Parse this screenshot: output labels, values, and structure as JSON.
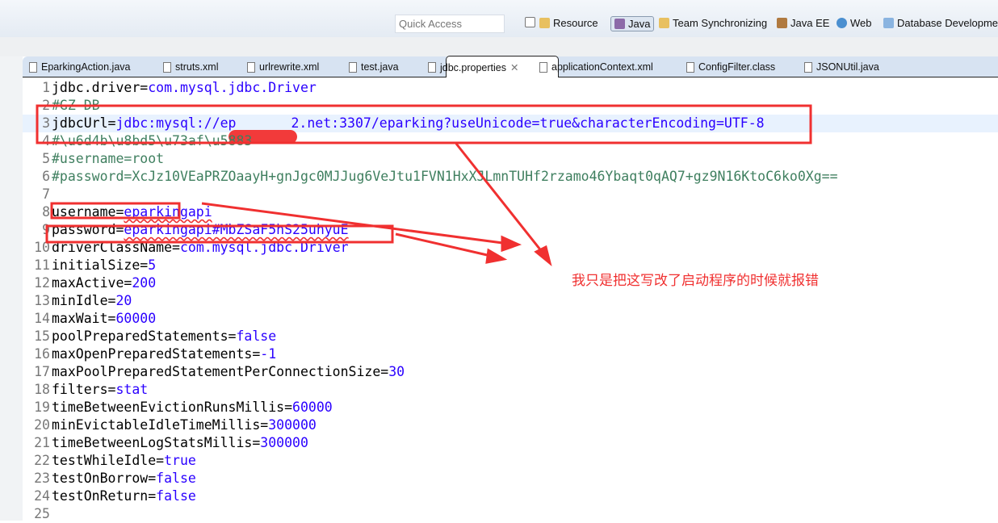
{
  "toolbar": {
    "quick_access_placeholder": "Quick Access",
    "perspectives": [
      {
        "label": "Resource"
      },
      {
        "label": "Java",
        "active": true
      },
      {
        "label": "Team Synchronizing"
      },
      {
        "label": "Java EE"
      },
      {
        "label": "Web"
      },
      {
        "label": "Database Developme"
      }
    ]
  },
  "tabs": [
    {
      "label": "EparkingAction.java"
    },
    {
      "label": "struts.xml"
    },
    {
      "label": "urlrewrite.xml"
    },
    {
      "label": "test.java"
    },
    {
      "label": "jdbc.properties",
      "active": true
    },
    {
      "label": "applicationContext.xml"
    },
    {
      "label": "ConfigFilter.class"
    },
    {
      "label": "JSONUtil.java"
    }
  ],
  "colors": {
    "key": "#000000",
    "value": "#2a00ff",
    "comment": "#3f7f5f",
    "annotation": "#f03030"
  },
  "editor": {
    "lines": [
      {
        "n": "1",
        "k": "jdbc.driver=",
        "v": "com.mysql.jdbc.Driver"
      },
      {
        "n": "2",
        "c": "#GZ DB"
      },
      {
        "n": "3",
        "k": "jdbcUrl=",
        "v": "jdbc:mysql://ep",
        "v2": "2.net:3307/eparking?useUnicode=true&characterEncoding=UTF-8"
      },
      {
        "n": "4",
        "c": "#\\u6d4b\\u8bd5\\u73af\\u5883"
      },
      {
        "n": "5",
        "c": "#username=root"
      },
      {
        "n": "6",
        "c": "#password=XcJz10VEaPRZOaayH+gnJgc0MJJug6VeJtu1FVN1HxXJLmnTUHf2rzamo46Ybaqt0qAQ7+gz9N16KtoC6ko0Xg=="
      },
      {
        "n": "7"
      },
      {
        "n": "8",
        "k": "username=",
        "v": "eparkingapi"
      },
      {
        "n": "9",
        "k": "password=",
        "v": "eparkingapi#MbZSaF5hS25uhyuE"
      },
      {
        "n": "10",
        "k": "driverClassName=",
        "v": "com.mysql.jdbc.Driver"
      },
      {
        "n": "11",
        "k": "initialSize=",
        "v": "5"
      },
      {
        "n": "12",
        "k": "maxActive=",
        "v": "200"
      },
      {
        "n": "13",
        "k": "minIdle=",
        "v": "20"
      },
      {
        "n": "14",
        "k": "maxWait=",
        "v": "60000"
      },
      {
        "n": "15",
        "k": "poolPreparedStatements=",
        "v": "false"
      },
      {
        "n": "16",
        "k": "maxOpenPreparedStatements=",
        "v": "-1"
      },
      {
        "n": "17",
        "k": "maxPoolPreparedStatementPerConnectionSize=",
        "v": "30"
      },
      {
        "n": "18",
        "k": "filters=",
        "v": "stat"
      },
      {
        "n": "19",
        "k": "timeBetweenEvictionRunsMillis=",
        "v": "60000"
      },
      {
        "n": "20",
        "k": "minEvictableIdleTimeMillis=",
        "v": "300000"
      },
      {
        "n": "21",
        "k": "timeBetweenLogStatsMillis=",
        "v": "300000"
      },
      {
        "n": "22",
        "k": "testWhileIdle=",
        "v": "true"
      },
      {
        "n": "23",
        "k": "testOnBorrow=",
        "v": "false"
      },
      {
        "n": "24",
        "k": "testOnReturn=",
        "v": "false"
      },
      {
        "n": "25"
      }
    ]
  },
  "annotation": {
    "note": "我只是把这写改了启动程序的时候就报错"
  }
}
